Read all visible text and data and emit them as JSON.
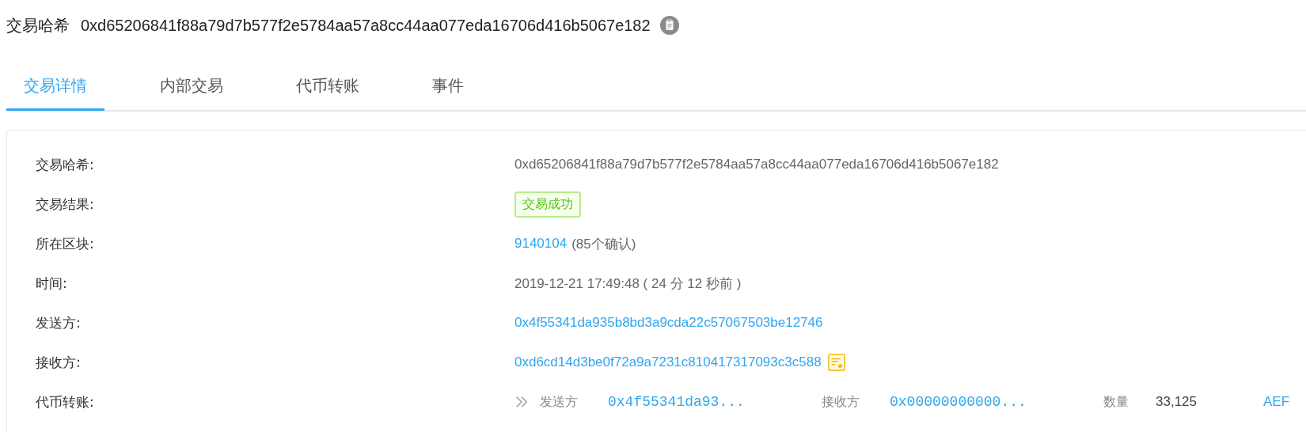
{
  "header": {
    "label": "交易哈希",
    "hash": "0xd65206841f88a79d7b577f2e5784aa57a8cc44aa077eda16706d416b5067e182"
  },
  "tabs": [
    {
      "label": "交易详情",
      "selected": true
    },
    {
      "label": "内部交易",
      "selected": false
    },
    {
      "label": "代币转账",
      "selected": false
    },
    {
      "label": "事件",
      "selected": false
    }
  ],
  "details": [
    {
      "kind": "text",
      "label": "交易哈希:",
      "value": "0xd65206841f88a79d7b577f2e5784aa57a8cc44aa077eda16706d416b5067e182"
    },
    {
      "kind": "badge",
      "label": "交易结果:",
      "value": "交易成功"
    },
    {
      "kind": "block",
      "label": "所在区块:",
      "value": "9140104",
      "note": "(85个确认)"
    },
    {
      "kind": "text",
      "label": "时间:",
      "value": "2019-12-21 17:49:48 ( 24 分 12 秒前 )"
    },
    {
      "kind": "link",
      "label": "发送方:",
      "value": "0x4f55341da935b8bd3a9cda22c57067503be12746"
    },
    {
      "kind": "contract",
      "label": "接收方:",
      "value": "0xd6cd14d3be0f72a9a7231c810417317093c3c588"
    },
    {
      "kind": "transfer",
      "label": "代币转账:",
      "from_label": "发送方",
      "from": "0x4f55341da93...",
      "to_label": "接收方",
      "to": "0x00000000000...",
      "amount_label": "数量",
      "amount": "33,125",
      "token": "AEF"
    }
  ]
}
